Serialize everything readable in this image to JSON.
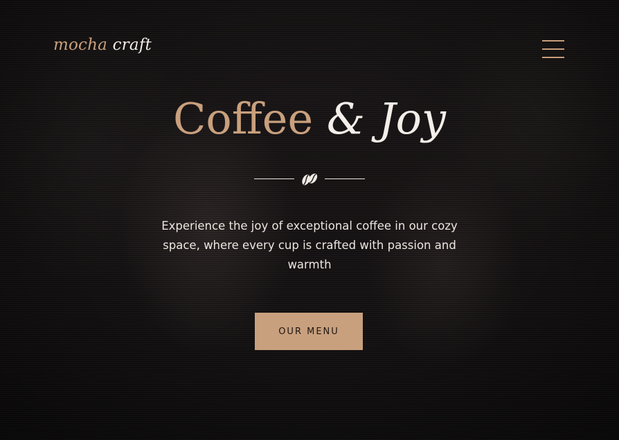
{
  "brand": {
    "word1": "mocha",
    "word2": "craft"
  },
  "hero": {
    "title_accent": "Coffee",
    "title_rest": "& Joy",
    "tagline": "Experience the joy of exceptional coffee in our cozy space, where every cup is crafted with passion and warmth",
    "cta_label": "OUR MENU"
  },
  "icons": {
    "menu": "hamburger-menu-icon",
    "divider": "coffee-bean-icon"
  },
  "colors": {
    "accent": "#c9a07d",
    "text_light": "#f3eee9",
    "background": "#171314"
  }
}
